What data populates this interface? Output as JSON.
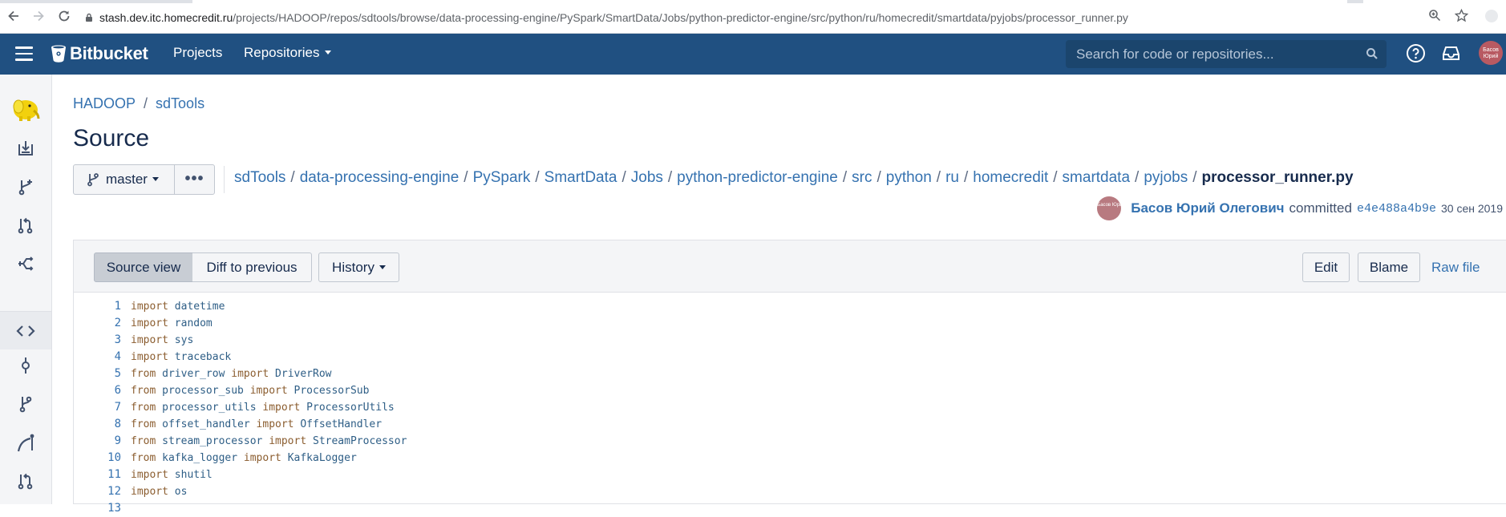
{
  "browser": {
    "url_host": "stash.dev.itc.homecredit.ru",
    "url_path": "/projects/HADOOP/repos/sdtools/browse/data-processing-engine/PySpark/SmartData/Jobs/python-predictor-engine/src/python/ru/homecredit/smartdata/pyjobs/processor_runner.py"
  },
  "header": {
    "logo_text": "Bitbucket",
    "nav": {
      "projects": "Projects",
      "repositories": "Repositories"
    },
    "search_placeholder": "Search for code or repositories...",
    "avatar_text": "Басов Юрий",
    "brand_color": "#205081"
  },
  "sidebar": {
    "items": [
      "project-avatar-icon",
      "clone-icon",
      "create-branch-icon",
      "create-pull-request-icon",
      "fork-icon",
      "source-icon",
      "commits-icon",
      "branches-icon",
      "graph-icon",
      "pull-requests-icon"
    ]
  },
  "breadcrumb": {
    "project": "HADOOP",
    "separator": "/",
    "repo": "sdTools"
  },
  "page_title": "Source",
  "branch": {
    "name": "master",
    "more_label": "•••"
  },
  "path": {
    "segments": [
      "sdTools",
      "data-processing-engine",
      "PySpark",
      "SmartData",
      "Jobs",
      "python-predictor-engine",
      "src",
      "python",
      "ru",
      "homecredit",
      "smartdata",
      "pyjobs"
    ],
    "separator": "/",
    "file": "processor_runner.py"
  },
  "commit": {
    "avatar_text": "Басов Юрий",
    "author": "Басов Юрий Олегович",
    "verb": "committed",
    "hash": "e4e488a4b9e",
    "date": "30 сен 2019"
  },
  "toolbar": {
    "source_view": "Source view",
    "diff_previous": "Diff to previous",
    "history": "History",
    "edit": "Edit",
    "blame": "Blame",
    "raw_file": "Raw file"
  },
  "code_lines": [
    {
      "n": "1",
      "kw1": "import",
      "mod": "datetime",
      "kw2": "",
      "name": ""
    },
    {
      "n": "2",
      "kw1": "import",
      "mod": "random",
      "kw2": "",
      "name": ""
    },
    {
      "n": "3",
      "kw1": "import",
      "mod": "sys",
      "kw2": "",
      "name": ""
    },
    {
      "n": "4",
      "kw1": "import",
      "mod": "traceback",
      "kw2": "",
      "name": ""
    },
    {
      "n": "5",
      "kw1": "from",
      "mod": "driver_row",
      "kw2": "import",
      "name": "DriverRow"
    },
    {
      "n": "6",
      "kw1": "from",
      "mod": "processor_sub",
      "kw2": "import",
      "name": "ProcessorSub"
    },
    {
      "n": "7",
      "kw1": "from",
      "mod": "processor_utils",
      "kw2": "import",
      "name": "ProcessorUtils"
    },
    {
      "n": "8",
      "kw1": "from",
      "mod": "offset_handler",
      "kw2": "import",
      "name": "OffsetHandler"
    },
    {
      "n": "9",
      "kw1": "from",
      "mod": "stream_processor",
      "kw2": "import",
      "name": "StreamProcessor"
    },
    {
      "n": "10",
      "kw1": "from",
      "mod": "kafka_logger",
      "kw2": "import",
      "name": "KafkaLogger"
    },
    {
      "n": "11",
      "kw1": "import",
      "mod": "shutil",
      "kw2": "",
      "name": ""
    },
    {
      "n": "12",
      "kw1": "import",
      "mod": "os",
      "kw2": "",
      "name": ""
    },
    {
      "n": "13",
      "kw1": "",
      "mod": "",
      "kw2": "",
      "name": ""
    }
  ]
}
